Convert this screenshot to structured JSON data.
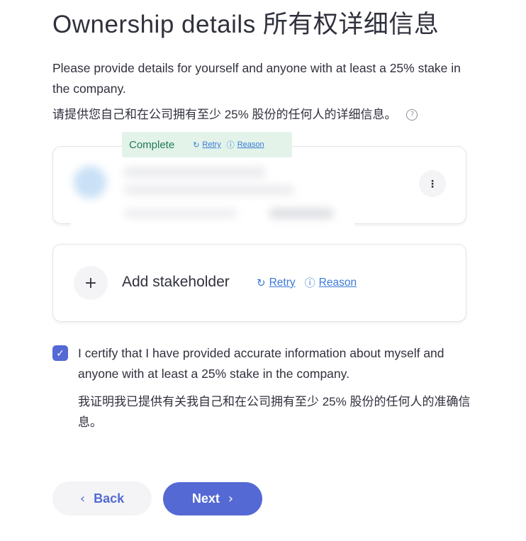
{
  "page": {
    "title": "Ownership details 所有权详细信息",
    "description": "Please provide details for yourself and anyone with at least a 25% stake in the company.",
    "description_cn": "请提供您自己和在公司拥有至少 25% 股份的任何人的详细信息。",
    "help_icon": "?"
  },
  "stakeholder_card": {
    "status": "Complete",
    "retry_icon": "↻",
    "retry_label": "Retry",
    "reason_icon": "ⓘ",
    "reason_label": "Reason",
    "more_icon": "⋮"
  },
  "add_card": {
    "plus_icon": "+",
    "label": "Add stakeholder",
    "retry_icon": "↻",
    "retry_label": "Retry",
    "reason_icon": "ⓘ",
    "reason_label": "Reason"
  },
  "certify": {
    "checked": true,
    "check_icon": "✓",
    "text": "I certify that I have provided accurate information about myself and anyone with at least a 25% stake in the company.",
    "text_cn": "我证明我已提供有关我自己和在公司拥有至少 25% 股份的任何人的准确信息。"
  },
  "nav": {
    "back_icon": "‹",
    "back_label": "Back",
    "next_label": "Next",
    "next_icon": "›"
  },
  "colors": {
    "accent": "#5469d4",
    "link": "#3a7ad6",
    "complete_bg": "#e3f3ea",
    "complete_text": "#217a53"
  }
}
